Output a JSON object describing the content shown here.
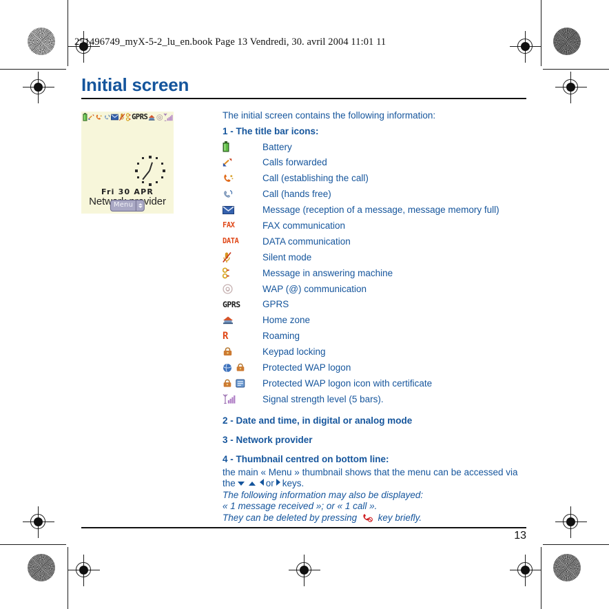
{
  "document": {
    "file_header": "251496749_myX-5-2_lu_en.book  Page 13  Vendredi, 30. avril 2004  11:01 11",
    "title": "Initial screen",
    "page_number": "13",
    "accent_color": "#15559c"
  },
  "phone_mock": {
    "screen_background": "#f7f6da",
    "date": "Fri 30 APR",
    "provider": "Network provider",
    "menu_label": "Menu",
    "status_icons": [
      "battery-icon",
      "calls-forwarded-icon",
      "call-establishing-icon",
      "call-hands-free-icon",
      "message-icon",
      "silent-mode-icon",
      "answering-machine-icon",
      "gprs-icon",
      "home-zone-icon",
      "wap-icon",
      "signal-strength-icon"
    ]
  },
  "body": {
    "intro": "The initial screen contains the following information:",
    "section1_heading": "1 - The title bar icons:",
    "icons": [
      {
        "icon": "battery-icon",
        "label": "Battery"
      },
      {
        "icon": "calls-forwarded-icon",
        "label": "Calls forwarded"
      },
      {
        "icon": "call-establishing-icon",
        "label": "Call (establishing the call)"
      },
      {
        "icon": "call-hands-free-icon",
        "label": "Call (hands free)"
      },
      {
        "icon": "message-icon",
        "label": "Message (reception of a message, message memory full)"
      },
      {
        "icon": "fax-icon",
        "label": "FAX communication"
      },
      {
        "icon": "data-icon",
        "label": "DATA communication"
      },
      {
        "icon": "silent-mode-icon",
        "label": "Silent mode"
      },
      {
        "icon": "answering-machine-icon",
        "label": "Message in answering machine"
      },
      {
        "icon": "wap-at-icon",
        "label": "WAP (@) communication"
      },
      {
        "icon": "gprs-icon",
        "label": "GPRS"
      },
      {
        "icon": "home-zone-icon",
        "label": "Home zone"
      },
      {
        "icon": "roaming-icon",
        "label": "Roaming"
      },
      {
        "icon": "keypad-lock-icon",
        "label": "Keypad locking"
      },
      {
        "icon": "protected-wap-logon-icon",
        "label": "Protected WAP logon"
      },
      {
        "icon": "protected-wap-certificate-icon",
        "label": "Protected WAP logon icon with certificate"
      },
      {
        "icon": "signal-strength-icon",
        "label": "Signal strength level (5 bars)."
      }
    ],
    "icon_glyph_text": {
      "fax": "FAX",
      "data": "DATA",
      "gprs": "GPRS",
      "roaming": "R"
    },
    "section2_heading": "2 - Date and time, in digital or analog mode",
    "section3_heading": "3 - Network provider",
    "section4_heading": "4 - Thumbnail centred on bottom line:",
    "thumb_text_1": "the main « Menu » thumbnail shows that the menu can be accessed via",
    "thumb_text_2a": "the",
    "thumb_text_2b": "or",
    "thumb_text_2c": "keys.",
    "note_1": "The following information may also be displayed:",
    "note_2": "« 1 message received »; or « 1 call ».",
    "note_3a": "They can be deleted by pressing",
    "note_3b": "key briefly."
  }
}
